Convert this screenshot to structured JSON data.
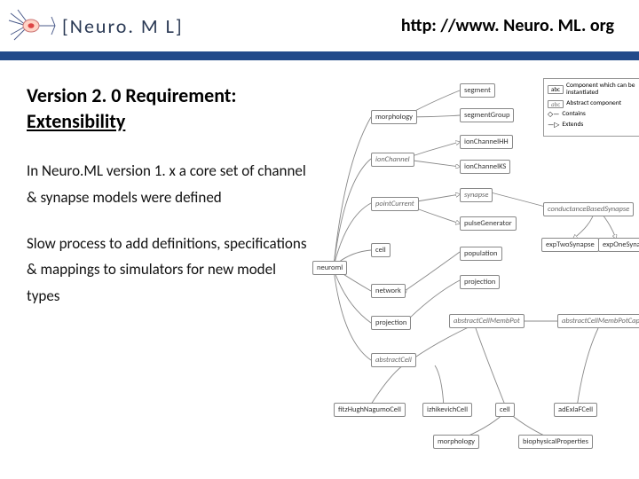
{
  "header": {
    "logo_text": "[Neuro. M L]",
    "url": "http: //www. Neuro. ML. org"
  },
  "title": "Version 2. 0 Requirement:",
  "subtitle": "Extensibility",
  "para1": "In Neuro.ML version 1. x a core set of channel & synapse models were defined",
  "para2": "Slow process to add definitions, specifications & mappings to simulators for new model types",
  "legend": {
    "box_concrete": "abc",
    "desc_concrete": "Component which can be instantiated",
    "box_abstract": "abc",
    "desc_abstract": "Abstract component",
    "contains": "Contains",
    "extends": "Extends"
  },
  "nodes": {
    "neuroml": "neuroml",
    "morphology": "morphology",
    "ionChannel": "ionChannel",
    "pointCurrent": "pointCurrent",
    "cell2": "cell",
    "network": "network",
    "projection": "projection",
    "abstractCell": "abstractCell",
    "segment": "segment",
    "segmentGroup": "segmentGroup",
    "ionChannelHH": "ionChannelHH",
    "ionChannelKS": "ionChannelKS",
    "synapse": "synapse",
    "pulseGenerator": "pulseGenerator",
    "population": "population",
    "abstractCellMembPot": "abstractCellMembPot",
    "conductanceBasedSynapse": "conductanceBasedSynapse",
    "expTwoSynapse": "expTwoSynapse",
    "expOneSynapse": "expOneSynapse",
    "abstractCellMembPotCap": "abstractCellMembPotCap",
    "fitzHughNagumoCell": "fitzHughNagumoCell",
    "izhikevichCell": "izhikevichCell",
    "cell": "cell",
    "adExIaFCell": "adExIaFCell",
    "morphology2": "morphology",
    "biophysicalProperties": "biophysicalProperties"
  }
}
